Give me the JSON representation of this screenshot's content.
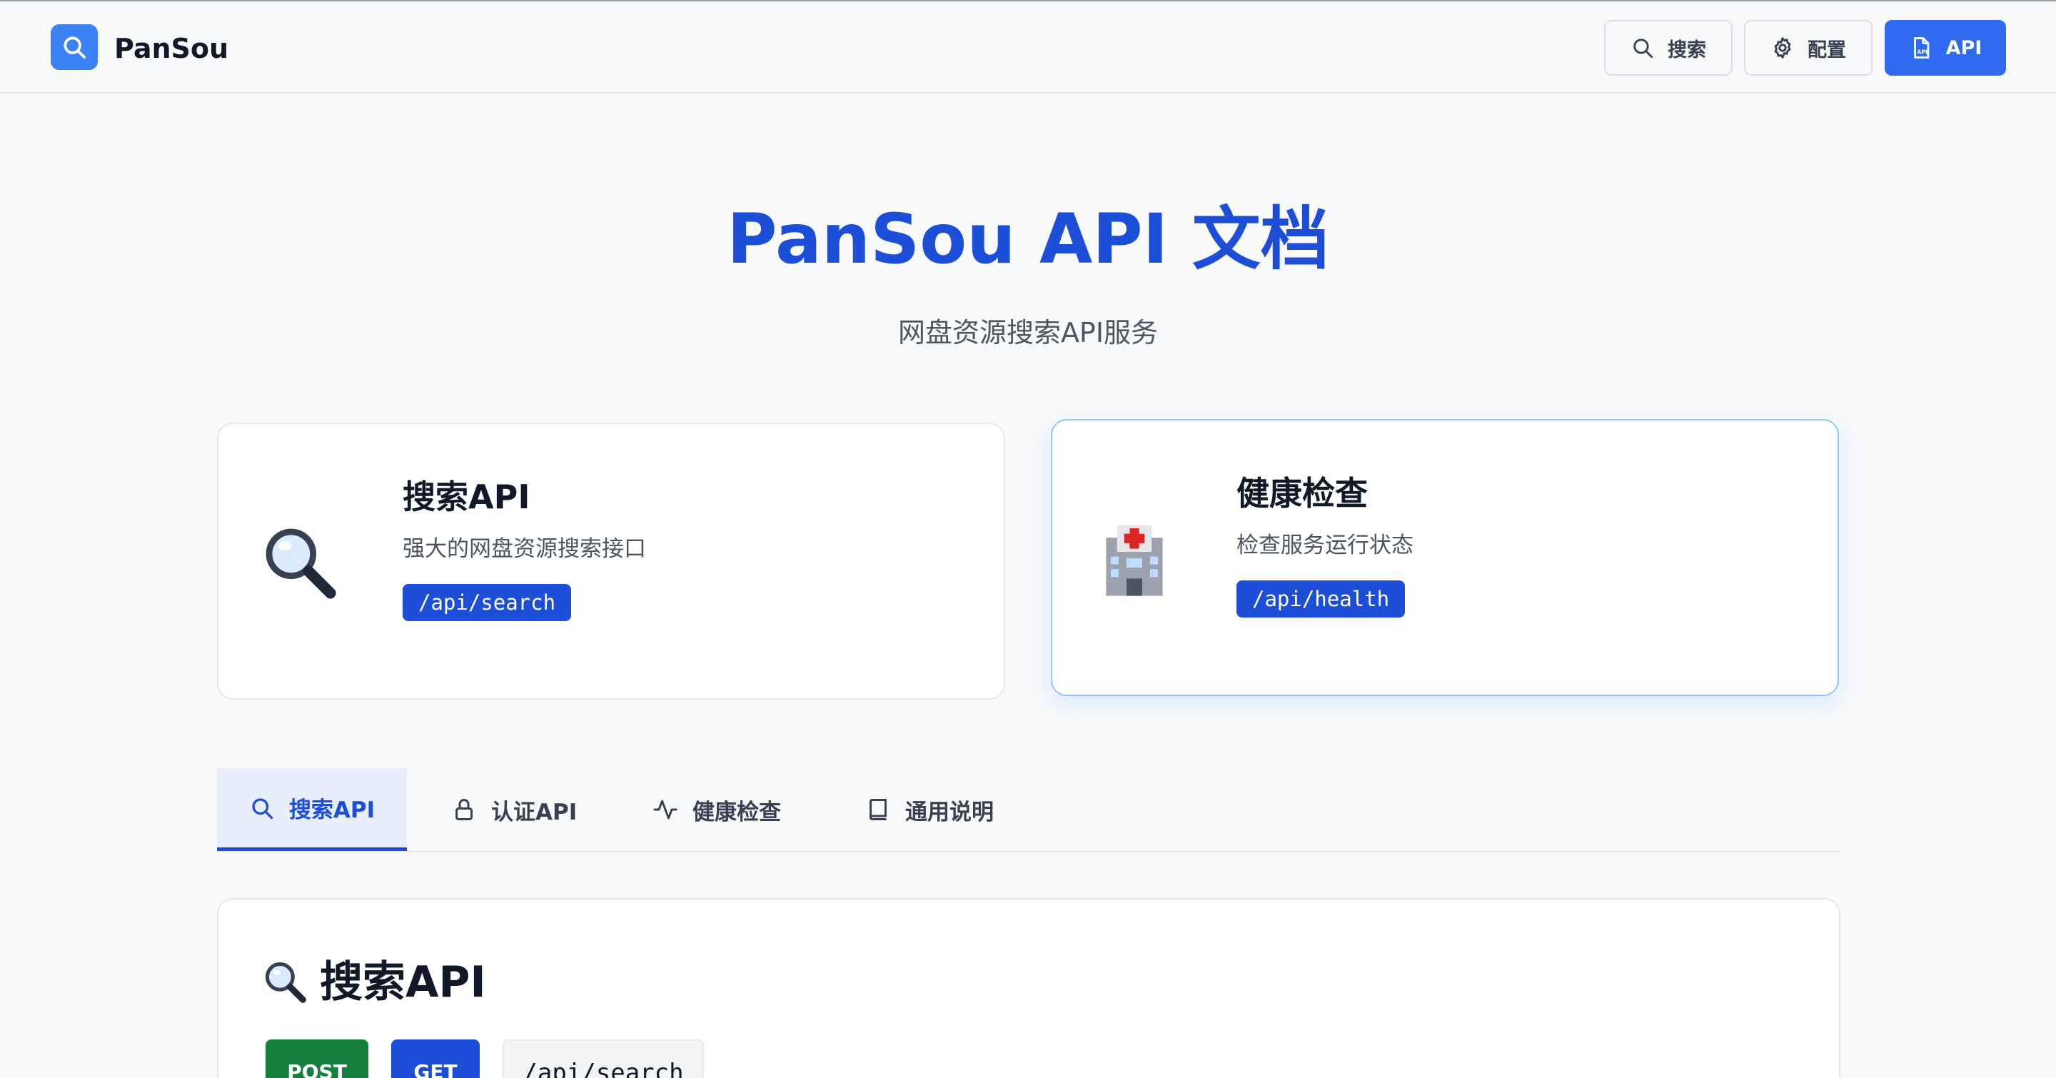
{
  "header": {
    "logo_text": "PanSou",
    "nav": [
      {
        "label": "搜索",
        "icon": "search-icon"
      },
      {
        "label": "配置",
        "icon": "gear-icon"
      },
      {
        "label": "API",
        "icon": "api-file-icon"
      }
    ]
  },
  "hero": {
    "title": "PanSou API 文档",
    "subtitle": "网盘资源搜索API服务"
  },
  "cards": [
    {
      "title": "搜索API",
      "description": "强大的网盘资源搜索接口",
      "endpoint": "/api/search",
      "icon": "magnifier-emoji-icon"
    },
    {
      "title": "健康检查",
      "description": "检查服务运行状态",
      "endpoint": "/api/health",
      "icon": "hospital-emoji-icon"
    }
  ],
  "tabs": [
    {
      "label": "搜索API",
      "icon": "search-icon",
      "active": true
    },
    {
      "label": "认证API",
      "icon": "lock-icon",
      "active": false
    },
    {
      "label": "健康检查",
      "icon": "activity-icon",
      "active": false
    },
    {
      "label": "通用说明",
      "icon": "book-icon",
      "active": false
    }
  ],
  "section": {
    "title": "搜索API",
    "methods": [
      "POST",
      "GET"
    ],
    "path": "/api/search"
  },
  "colors": {
    "primary": "#2f6bf0",
    "title_blue": "#1d4ed8",
    "post_green": "#15803d",
    "page_bg": "#f8f9fa"
  }
}
